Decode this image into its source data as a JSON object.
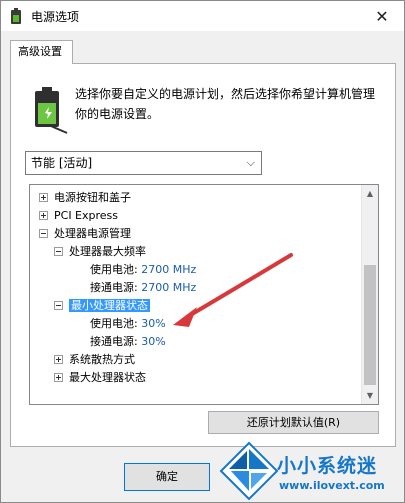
{
  "window": {
    "title": "电源选项"
  },
  "tab": {
    "label": "高级设置"
  },
  "description": "选择你要自定义的电源计划，然后选择你希望计算机管理你的电源设置。",
  "plan_select": {
    "value": "节能 [活动]"
  },
  "tree": {
    "items": [
      {
        "label": "电源按钮和盖子",
        "expander": "plus"
      },
      {
        "label": "PCI Express",
        "expander": "plus"
      },
      {
        "label": "处理器电源管理",
        "expander": "minus"
      },
      {
        "label": "处理器最大频率",
        "expander": "minus"
      },
      {
        "label": "使用电池:",
        "value": "2700 MHz"
      },
      {
        "label": "接通电源:",
        "value": "2700 MHz"
      },
      {
        "label": "最小处理器状态",
        "expander": "minus"
      },
      {
        "label": "使用电池:",
        "value": "30%"
      },
      {
        "label": "接通电源:",
        "value": "30%"
      },
      {
        "label": "系统散热方式",
        "expander": "plus"
      },
      {
        "label": "最大处理器状态",
        "expander": "plus"
      }
    ]
  },
  "buttons": {
    "restore": "还原计划默认值(R)",
    "ok": "确定"
  },
  "watermark": {
    "title": "小小系统迷",
    "url": "www.ilovext.com"
  },
  "colors": {
    "arrow": "#d9383a",
    "selection": "#3399ff",
    "value_text": "#1a5cb3",
    "watermark": "#1677c9"
  }
}
